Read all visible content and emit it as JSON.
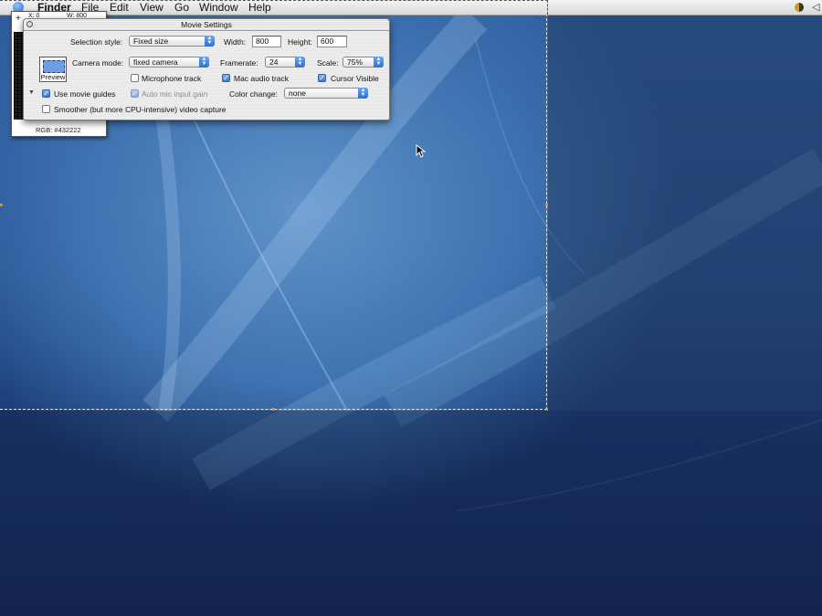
{
  "menubar": {
    "items": [
      "Finder",
      "File",
      "Edit",
      "View",
      "Go",
      "Window",
      "Help"
    ]
  },
  "magnifier": {
    "x_readout": "X: 0",
    "w_readout": "W: 800",
    "rgb_readout": "RGB: #432222"
  },
  "window": {
    "title": "Movie Settings",
    "selection_style_label": "Selection style:",
    "selection_style_value": "Fixed size",
    "width_label": "Width:",
    "width_value": "800",
    "height_label": "Height:",
    "height_value": "600",
    "preview_label": "Preview",
    "camera_mode_label": "Camera mode:",
    "camera_mode_value": "fixed camera",
    "framerate_label": "Framerate:",
    "framerate_value": "24",
    "scale_label": "Scale:",
    "scale_value": "75%",
    "microphone_track_label": "Microphone track",
    "microphone_track_checked": false,
    "mac_audio_track_label": "Mac audio track",
    "mac_audio_track_checked": true,
    "cursor_visible_label": "Cursor Visible",
    "cursor_visible_checked": true,
    "use_movie_guides_label": "Use movie guides",
    "use_movie_guides_checked": true,
    "auto_mic_gain_label": "Auto mic input gain",
    "auto_mic_gain_checked": true,
    "color_change_label": "Color change:",
    "color_change_value": "none",
    "smoother_label": "Smoother (but more CPU-intensive) video capture",
    "smoother_checked": false
  },
  "icons": {
    "apple": "apple-icon",
    "close": "close-icon",
    "crosshair": "crosshair-icon",
    "cursor": "arrow-cursor-icon"
  },
  "colors": {
    "accent": "#3a77d6",
    "handle": "#e38a2a"
  }
}
